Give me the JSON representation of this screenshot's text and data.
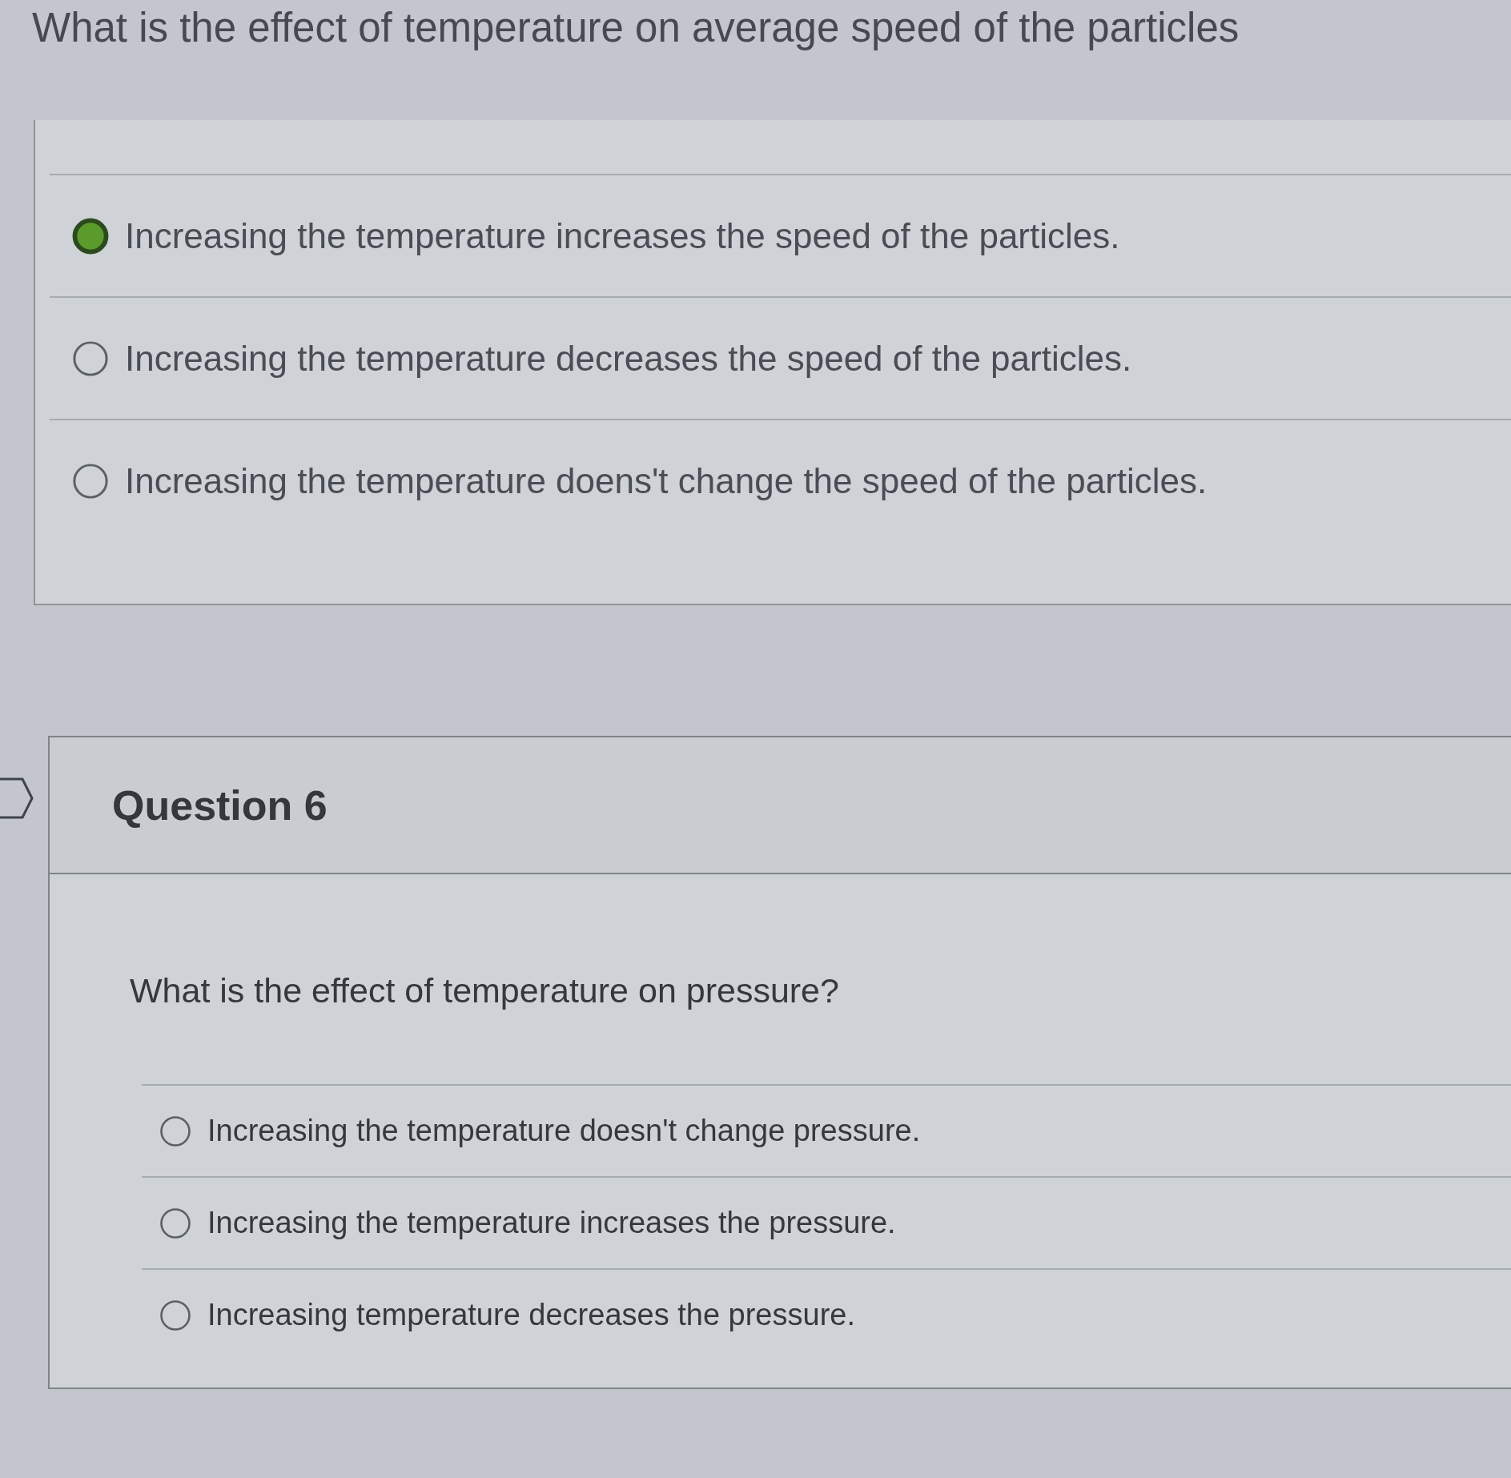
{
  "question_5": {
    "prompt": "What is the effect of temperature on average speed of the particles",
    "options": [
      {
        "label": "Increasing the temperature increases the speed of the particles.",
        "selected": true
      },
      {
        "label": "Increasing the temperature decreases the speed of the particles.",
        "selected": false
      },
      {
        "label": "Increasing the temperature doens't change the speed of the particles.",
        "selected": false
      }
    ]
  },
  "question_6": {
    "title": "Question 6",
    "prompt": "What is the effect of temperature on pressure?",
    "options": [
      {
        "label": "Increasing the temperature doesn't change pressure.",
        "selected": false
      },
      {
        "label": "Increasing the temperature increases the pressure.",
        "selected": false
      },
      {
        "label": "Increasing temperature decreases the pressure.",
        "selected": false
      }
    ]
  }
}
